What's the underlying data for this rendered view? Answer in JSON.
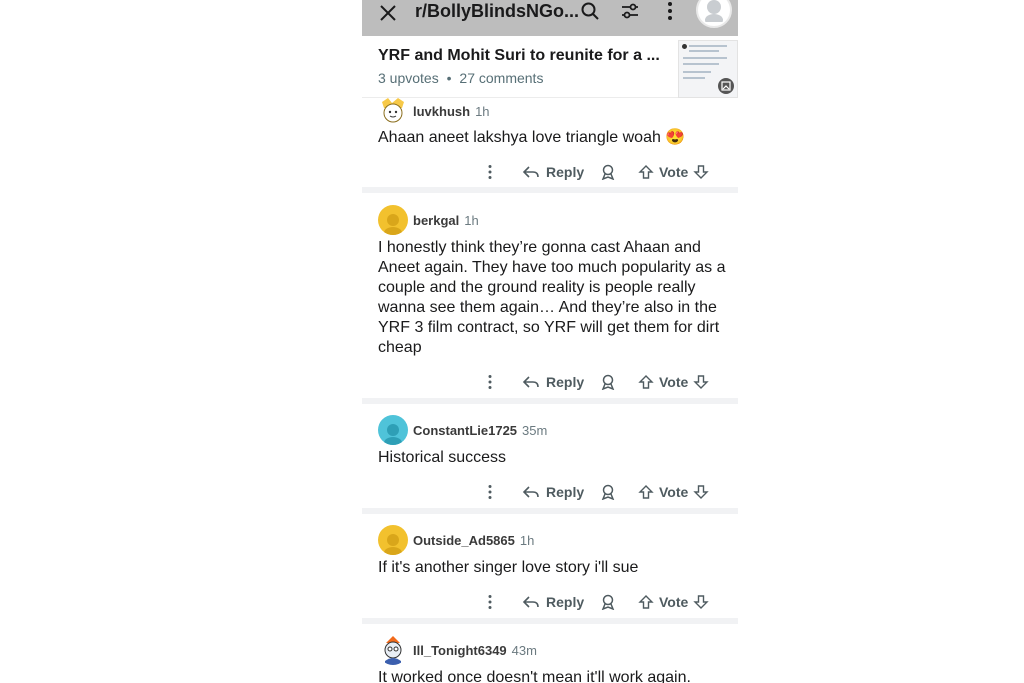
{
  "topbar": {
    "subreddit": "r/BollyBlindsNGo...",
    "icons": [
      "close-icon",
      "search-icon",
      "filter-icon",
      "kebab-icon",
      "avatar-icon"
    ]
  },
  "post": {
    "title": "YRF and Mohit Suri to reunite for a ...",
    "upvotes": "3 upvotes",
    "separator": "•",
    "comments": "27 comments"
  },
  "actions": {
    "reply": "Reply",
    "vote": "Vote"
  },
  "comments": [
    {
      "user": "luvkhush",
      "time": "1h",
      "avatar_color": "#f7c948",
      "text": "Ahaan aneet lakshya love triangle woah 😍"
    },
    {
      "user": "berkgal",
      "time": "1h",
      "avatar_color": "#f2c12e",
      "text": "I honestly think they’re gonna cast Ahaan and Aneet again. They have too much popularity as a couple and the ground reality is people really wanna see them again… And they’re also in the YRF 3 film contract, so YRF will get them for dirt cheap"
    },
    {
      "user": "ConstantLie1725",
      "time": "35m",
      "avatar_color": "#4fc3d9",
      "text": "Historical success"
    },
    {
      "user": "Outside_Ad5865",
      "time": "1h",
      "avatar_color": "#f2c12e",
      "text": "If it's another singer love story i'll sue"
    },
    {
      "user": "Ill_Tonight6349",
      "time": "43m",
      "avatar_color": "#e8eef5",
      "text": "It worked once doesn't mean it'll work again."
    }
  ]
}
